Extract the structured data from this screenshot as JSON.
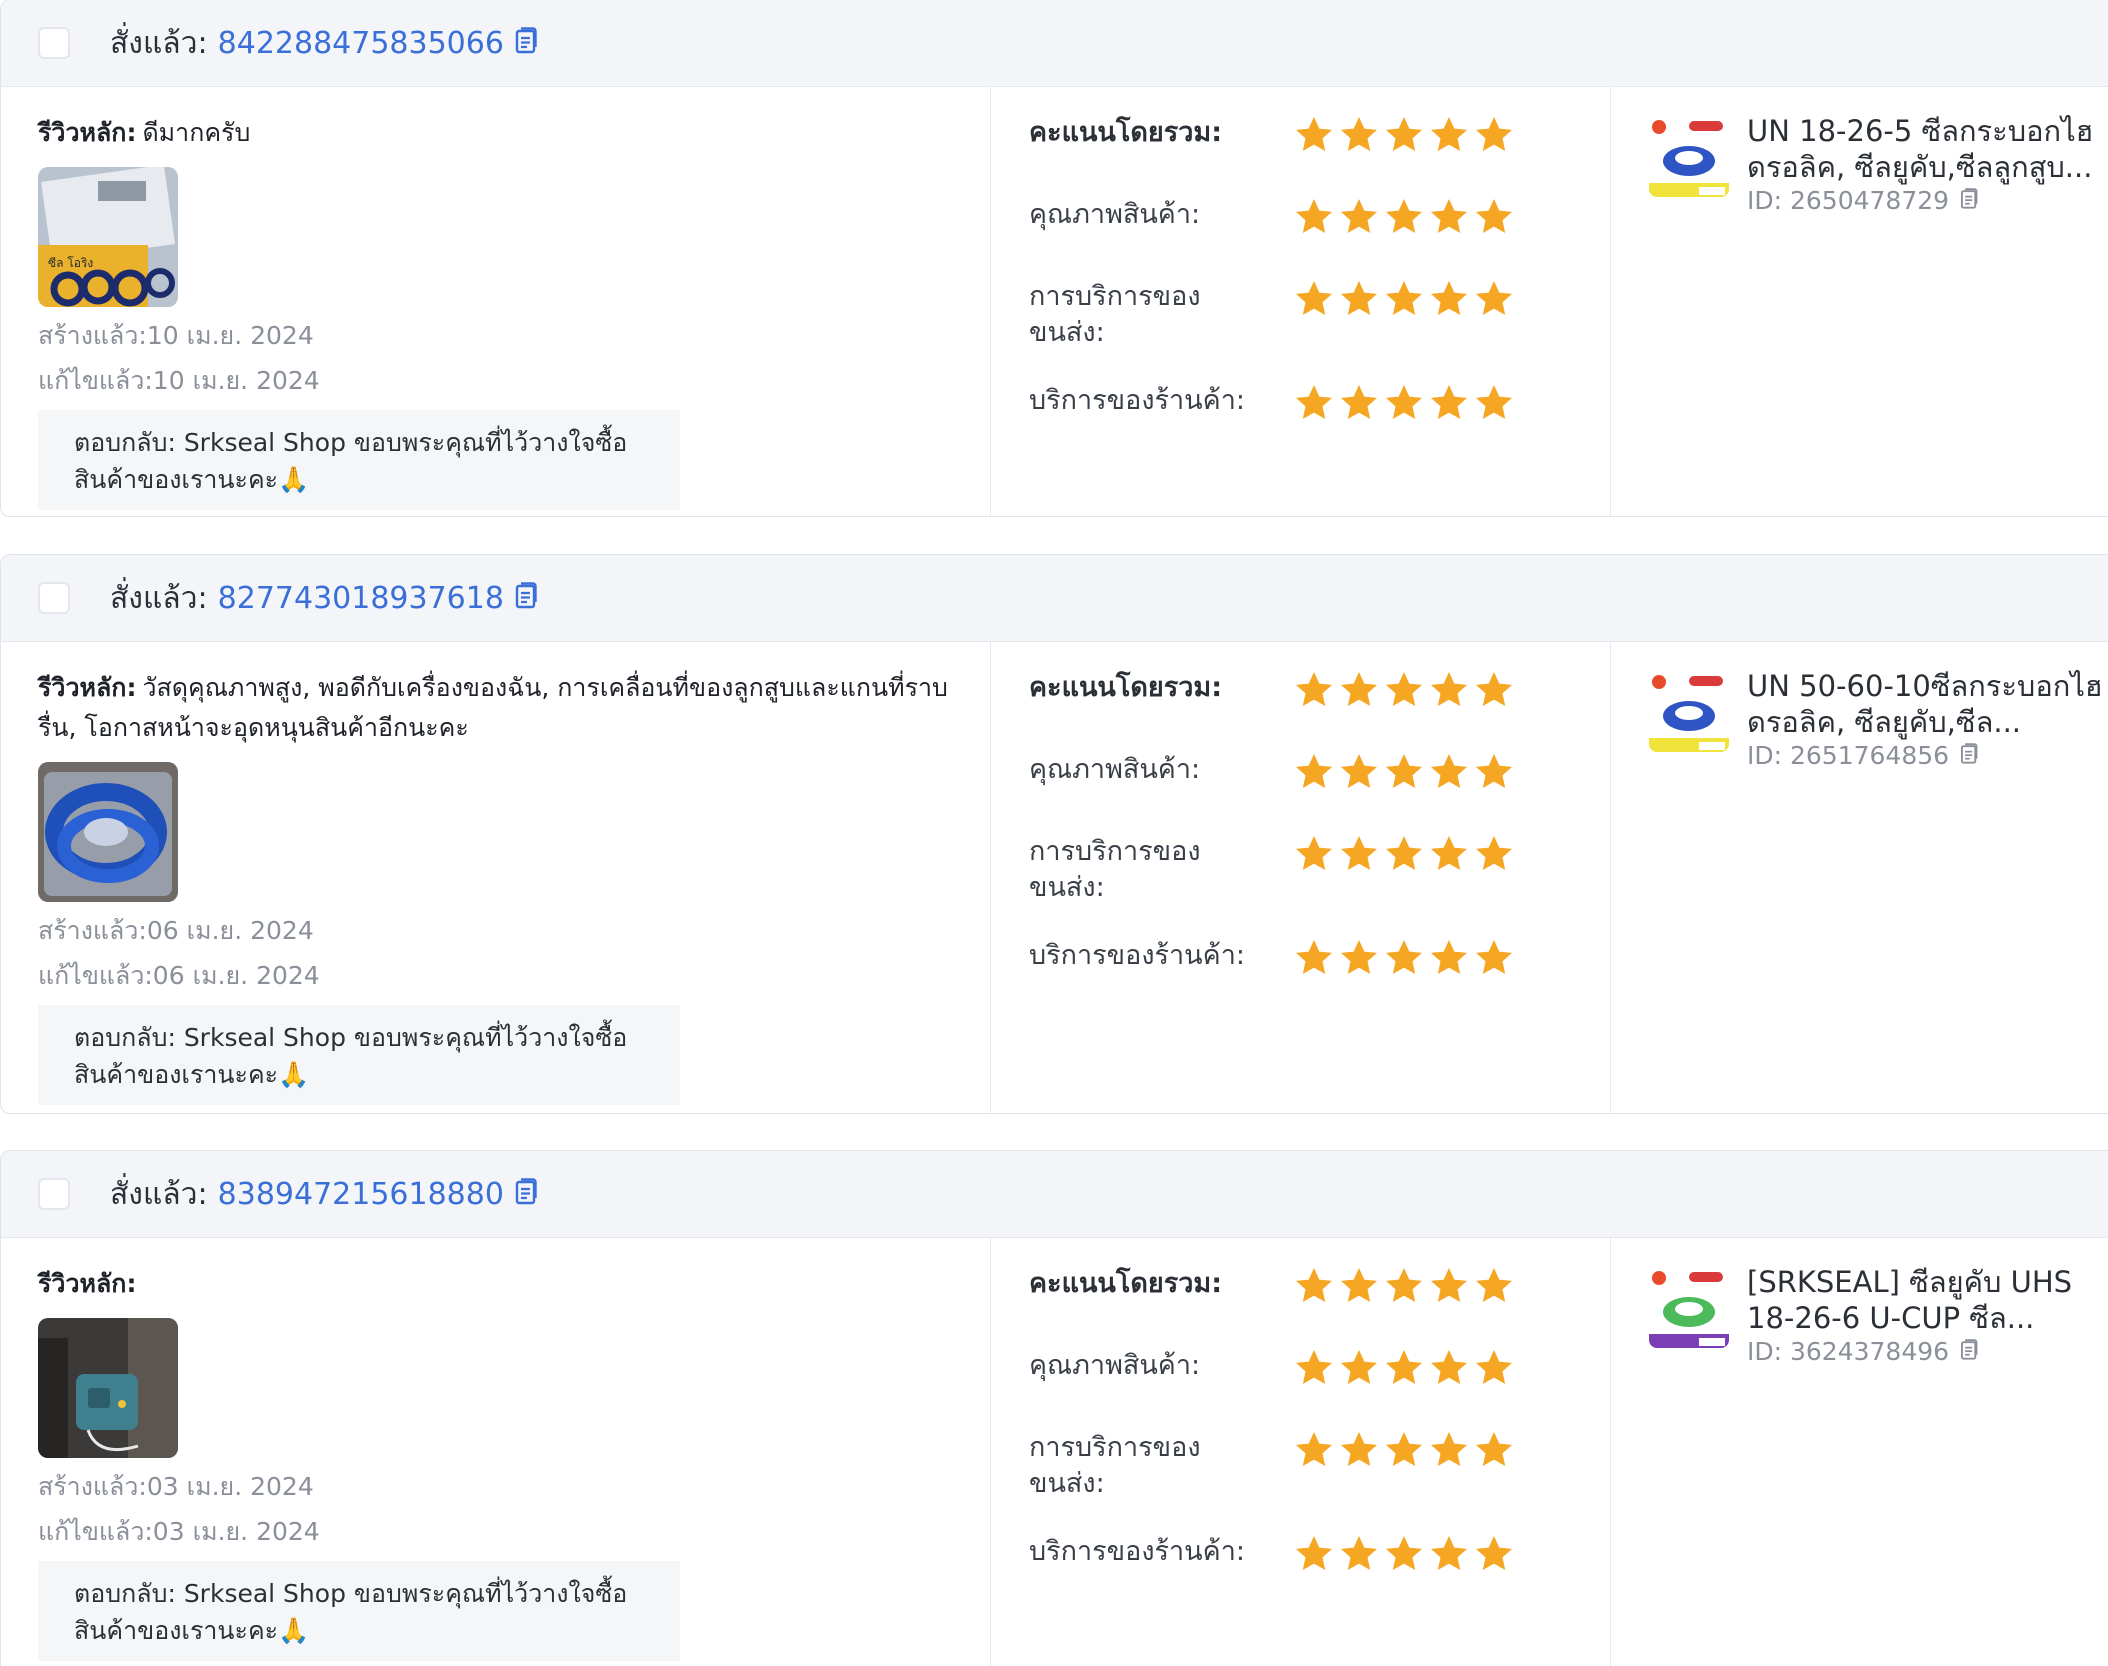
{
  "common": {
    "ordered_label": "สั่งแล้ว:",
    "review_label": "รีวิวหลัก:",
    "rating_labels": {
      "overall": "คะแนนโดยรวม:",
      "quality": "คุณภาพสินค้า:",
      "shipping": "การบริการของขนส่ง:",
      "shop": "บริการของร้านค้า:"
    },
    "star_color": "#f5a623"
  },
  "reviews": [
    {
      "order_id": "842288475835066",
      "review_text": "ดีมากครับ",
      "created": "สร้างแล้ว:10 เม.ย. 2024",
      "edited": "แก้ไขแล้ว:10 เม.ย. 2024",
      "reply": "ตอบกลับ: Srkseal Shop ขอบพระคุณที่ไว้วางใจซื้อสินค้าของเรานะคะ🙏",
      "ratings": {
        "overall": 5,
        "quality": 5,
        "shipping": 5,
        "shop": 5
      },
      "product": {
        "title": "UN 18-26-5 ซีลกระบอกไฮดรอลิค, ซีลยูคับ,ซีลลูกสูบ...",
        "id": "ID: 2650478729",
        "seal_color": "#2f55c4"
      }
    },
    {
      "order_id": "827743018937618",
      "review_text": "วัสดุคุณภาพสูง, พอดีกับเครื่องของฉัน, การเคลื่อนที่ของลูกสูบและแกนที่ราบรื่น, โอกาสหน้าจะอุดหนุนสินค้าอีกนะคะ",
      "created": "สร้างแล้ว:06 เม.ย. 2024",
      "edited": "แก้ไขแล้ว:06 เม.ย. 2024",
      "reply": "ตอบกลับ: Srkseal Shop ขอบพระคุณที่ไว้วางใจซื้อสินค้าของเรานะคะ🙏",
      "ratings": {
        "overall": 5,
        "quality": 5,
        "shipping": 5,
        "shop": 5
      },
      "product": {
        "title": "UN 50-60-10ซีลกระบอกไฮดรอลิค, ซีลยูคับ,ซีล...",
        "id": "ID: 2651764856",
        "seal_color": "#2f55c4"
      }
    },
    {
      "order_id": "838947215618880",
      "review_text": "",
      "created": "สร้างแล้ว:03 เม.ย. 2024",
      "edited": "แก้ไขแล้ว:03 เม.ย. 2024",
      "reply": "ตอบกลับ: Srkseal Shop ขอบพระคุณที่ไว้วางใจซื้อสินค้าของเรานะคะ🙏",
      "ratings": {
        "overall": 5,
        "quality": 5,
        "shipping": 5,
        "shop": 5
      },
      "product": {
        "title": "[SRKSEAL] ซีลยูคับ UHS 18-26-6 U-CUP ซีล...",
        "id": "ID: 3624378496",
        "seal_color": "#4cba5a"
      }
    }
  ]
}
